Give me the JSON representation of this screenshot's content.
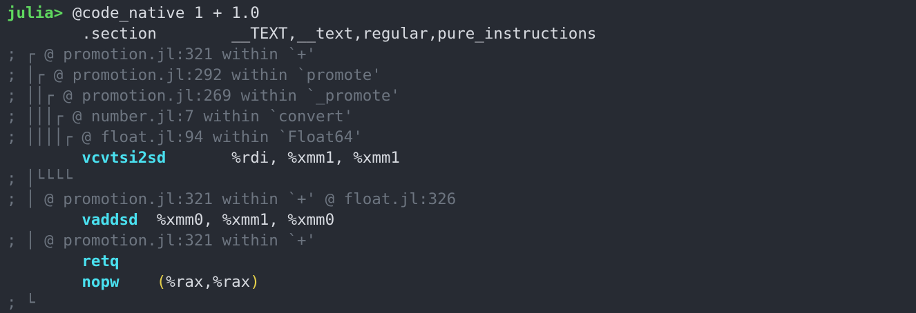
{
  "prompt": "julia>",
  "command": " @code_native 1 + 1.0",
  "colors": {
    "background": "#272b33",
    "prompt": "#5fd75f",
    "text": "#d7dae0",
    "comment": "#6d7580",
    "mnemonic": "#4ae1f0",
    "paren": "#e5d04a"
  },
  "output": [
    {
      "type": "directive",
      "text": "        .section        __TEXT,__text,regular,pure_instructions"
    },
    {
      "type": "comment",
      "text": "; ┌ @ promotion.jl:321 within `+'"
    },
    {
      "type": "comment",
      "text": "; │┌ @ promotion.jl:292 within `promote'"
    },
    {
      "type": "comment",
      "text": "; ││┌ @ promotion.jl:269 within `_promote'"
    },
    {
      "type": "comment",
      "text": "; │││┌ @ number.jl:7 within `convert'"
    },
    {
      "type": "comment",
      "text": "; ││││┌ @ float.jl:94 within `Float64'"
    },
    {
      "type": "instr",
      "indent": "        ",
      "mnemonic": "vcvtsi2sd",
      "gap": "       ",
      "operands": "%rdi, %xmm1, %xmm1"
    },
    {
      "type": "comment",
      "text": "; │└└└└"
    },
    {
      "type": "comment",
      "text": "; │ @ promotion.jl:321 within `+' @ float.jl:326"
    },
    {
      "type": "instr",
      "indent": "        ",
      "mnemonic": "vaddsd",
      "gap": "  ",
      "operands": "%xmm0, %xmm1, %xmm0"
    },
    {
      "type": "comment",
      "text": "; │ @ promotion.jl:321 within `+'"
    },
    {
      "type": "instr",
      "indent": "        ",
      "mnemonic": "retq",
      "gap": "",
      "operands": ""
    },
    {
      "type": "instr_paren",
      "indent": "        ",
      "mnemonic": "nopw",
      "gap": "    ",
      "open": "(",
      "operands": "%rax,%rax",
      "close": ")"
    },
    {
      "type": "comment",
      "text": "; └"
    }
  ]
}
